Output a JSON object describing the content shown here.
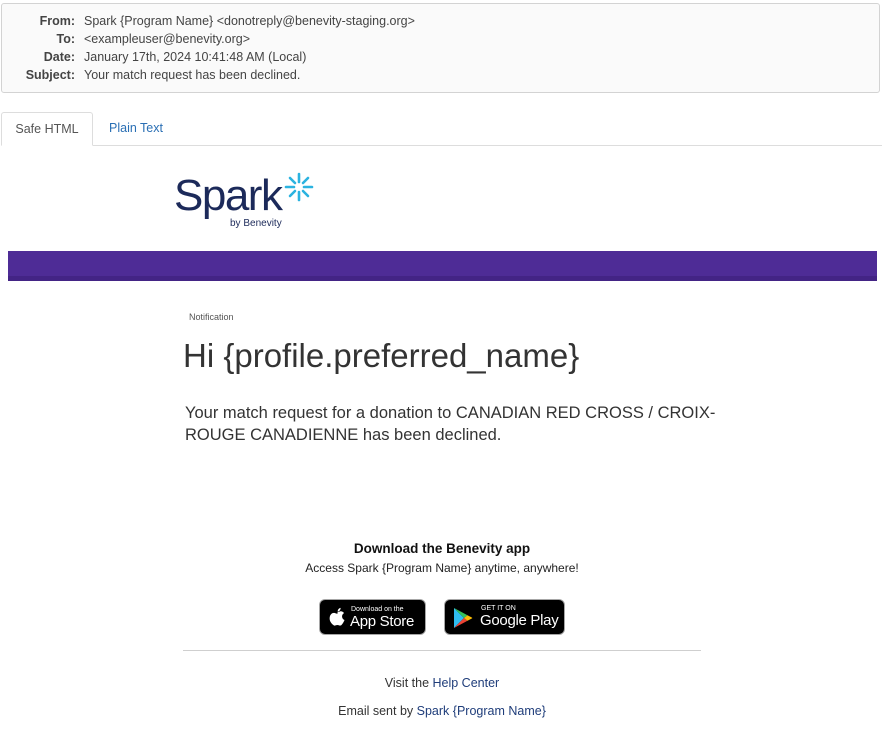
{
  "header": {
    "from_label": "From:",
    "from_value": "Spark {Program Name} <donotreply@benevity-staging.org>",
    "to_label": "To:",
    "to_value": "<exampleuser@benevity.org>",
    "date_label": "Date:",
    "date_value": "January 17th, 2024 10:41:48 AM (Local)",
    "subject_label": "Subject:",
    "subject_value": "Your match request has been declined."
  },
  "tabs": [
    {
      "label": "Safe HTML",
      "active": true
    },
    {
      "label": "Plain Text",
      "active": false
    }
  ],
  "logo": {
    "word": "Spark",
    "sub": "by Benevity"
  },
  "colors": {
    "banner": "#4e2c96",
    "link": "#1f3d7a",
    "tab_link": "#2a6fb4",
    "logo": "#1c2a5a",
    "star": "#2bb3e0"
  },
  "email": {
    "notification_label": "Notification",
    "greeting": "Hi {profile.preferred_name}",
    "message": "Your match request for a donation to CANADIAN RED CROSS / CROIX-ROUGE CANADIENNE has been declined."
  },
  "app": {
    "title": "Download the Benevity app",
    "subtitle": "Access Spark {Program Name} anytime, anywhere!",
    "app_store_small": "Download on the",
    "app_store_big": "App Store",
    "google_small": "GET IT ON",
    "google_big": "Google Play"
  },
  "footer": {
    "visit_prefix": "Visit the ",
    "help_link": "Help Center",
    "sent_prefix": "Email sent by ",
    "sender_link": "Spark {Program Name}"
  }
}
